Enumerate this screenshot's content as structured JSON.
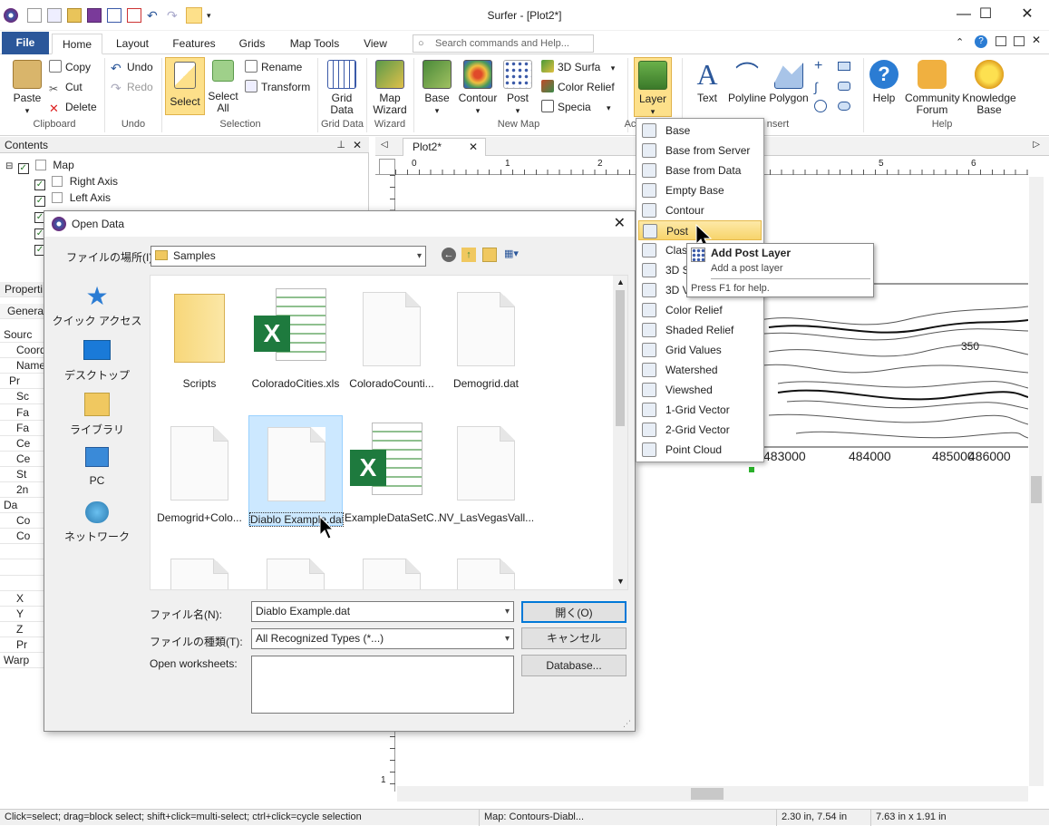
{
  "app": {
    "title": "Surfer - [Plot2*]"
  },
  "window_controls": {
    "minimize": "—",
    "maximize": "☐",
    "close": "✕"
  },
  "tabs": [
    {
      "label": "File"
    },
    {
      "label": "Home"
    },
    {
      "label": "Layout"
    },
    {
      "label": "Features"
    },
    {
      "label": "Grids"
    },
    {
      "label": "Map Tools"
    },
    {
      "label": "View"
    }
  ],
  "search": {
    "placeholder": "Search commands and Help..."
  },
  "ribbon": {
    "clipboard": {
      "paste": "Paste",
      "copy": "Copy",
      "cut": "Cut",
      "delete": "Delete",
      "group": "Clipboard"
    },
    "undo": {
      "undo": "Undo",
      "redo": "Redo",
      "group": "Undo"
    },
    "selection": {
      "select": "Select",
      "select_all": "Select All",
      "rename": "Rename",
      "transform": "Transform",
      "group": "Selection"
    },
    "grid_data": {
      "label": "Grid Data",
      "group": "Grid Data"
    },
    "wizard": {
      "label": "Map Wizard",
      "group": "Wizard"
    },
    "new_map": {
      "base": "Base",
      "contour": "Contour",
      "post": "Post",
      "surface": "3D Surfa",
      "color_relief": "Color Relief",
      "specialty": "Specia",
      "group": "New Map"
    },
    "add": {
      "layer": "Layer",
      "group": "Ac"
    },
    "insert": {
      "text": "Text",
      "polyline": "Polyline",
      "polygon": "Polygon",
      "group": "nsert"
    },
    "help": {
      "help": "Help",
      "forum": "Community Forum",
      "kb": "Knowledge Base",
      "group": "Help"
    }
  },
  "contents": {
    "header": "Contents",
    "items": [
      "Map",
      "Right Axis",
      "Left Axis"
    ]
  },
  "properties": {
    "header": "Properti",
    "tab": "Genera",
    "rows": [
      "Sourc",
      "Coord",
      "Name",
      "Pr",
      "Sc",
      "Fa",
      "Fa",
      "Ce",
      "Ce",
      "St",
      "2n",
      "Da",
      "Co",
      "Co",
      "",
      "",
      "",
      "X",
      "Y",
      "Z",
      "Pr",
      "Warp"
    ]
  },
  "document": {
    "tab": "Plot2*",
    "ruler_labels": [
      "0",
      "1",
      "2",
      "5",
      "6"
    ],
    "axis_labels": [
      "483000",
      "484000",
      "485000",
      "486000"
    ],
    "contour_label": "350",
    "left_ruler_label": "1"
  },
  "layer_menu": {
    "items": [
      "Base",
      "Base from Server",
      "Base from Data",
      "Empty Base",
      "Contour",
      "Post",
      "Class",
      "3D S",
      "3D V",
      "Color Relief",
      "Shaded Relief",
      "Grid Values",
      "Watershed",
      "Viewshed",
      "1-Grid Vector",
      "2-Grid Vector",
      "Point Cloud"
    ],
    "highlighted": "Post"
  },
  "tooltip": {
    "title": "Add Post Layer",
    "desc": "Add a post layer",
    "help": "Press F1 for help."
  },
  "dialog": {
    "title": "Open Data",
    "location_label": "ファイルの場所(I):",
    "location_value": "Samples",
    "nav": [
      "クイック アクセス",
      "デスクトップ",
      "ライブラリ",
      "PC",
      "ネットワーク"
    ],
    "files": [
      {
        "name": "Scripts",
        "type": "folder"
      },
      {
        "name": "ColoradoCities.xls",
        "type": "excel"
      },
      {
        "name": "ColoradoCounti...",
        "type": "file"
      },
      {
        "name": "Demogrid.dat",
        "type": "file"
      },
      {
        "name": "Demogrid+Colo...",
        "type": "file"
      },
      {
        "name": "Diablo Example.dat",
        "type": "file"
      },
      {
        "name": "ExampleDataSetC...",
        "type": "excel"
      },
      {
        "name": "NV_LasVegasVall...",
        "type": "file"
      }
    ],
    "selected_file": "Diablo Example.dat",
    "filename_label": "ファイル名(N):",
    "filename_value": "Diablo Example.dat",
    "filetype_label": "ファイルの種類(T):",
    "filetype_value": "All Recognized Types (*...)",
    "worksheets_label": "Open worksheets:",
    "open_button": "開く(O)",
    "cancel_button": "キャンセル",
    "database_button": "Database..."
  },
  "status": {
    "hint": "Click=select; drag=block select; shift+click=multi-select; ctrl+click=cycle selection",
    "map": "Map: Contours-Diabl...",
    "pos": "2.30 in, 7.54 in",
    "size": "7.63 in x 1.91 in"
  },
  "colors": {
    "accent": "#2b579a",
    "highlight": "#f7d46b",
    "select_bg": "#cce8ff"
  }
}
